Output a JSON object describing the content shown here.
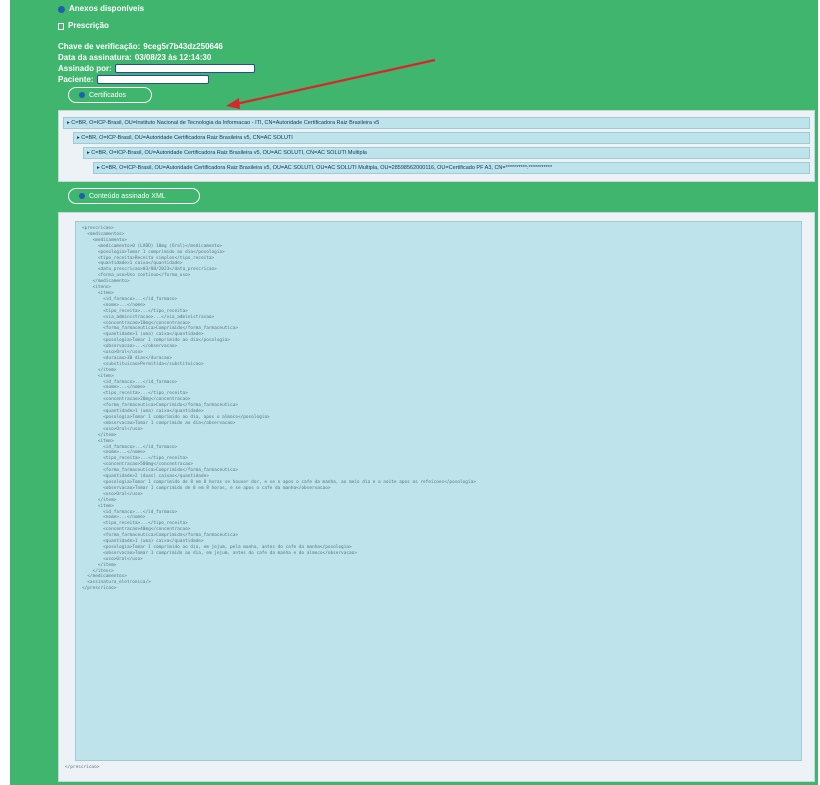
{
  "links": {
    "anexos_label": "Anexos disponíveis",
    "prescricao_label": "Prescrição"
  },
  "info": {
    "chave_label": "Chave de verificação:",
    "chave_value": "9ceg5r7b43dz250646",
    "data_label": "Data da assinatura:",
    "data_value": "03/08/23 às 12:14:30",
    "assinado_label": "Assinado por:",
    "paciente_label": "Paciente:"
  },
  "buttons": {
    "certificates_label": "Certificados",
    "xml_label": "Conteúdo assinado XML"
  },
  "chain": [
    "C=BR, O=ICP-Brasil, OU=Instituto Nacional de Tecnologia da Informacao - ITI, CN=Autoridade Certificadora Raiz Brasileira v5",
    "C=BR, O=ICP-Brasil, OU=Autoridade Certificadora Raiz Brasileira v5, CN=AC SOLUTI",
    "C=BR, O=ICP-Brasil, OU=Autoridade Certificadora Raiz Brasileira v5, OU=AC SOLUTI, CN=AC SOLUTI Multipla",
    "C=BR, O=ICP-Brasil, OU=Autoridade Certificadora Raiz Brasileira v5, OU=AC SOLUTI, OU=AC SOLUTI Multipla, OU=28598562000116, OU=Certificado PF A3, CN=**********:***********"
  ],
  "xml_lines": [
    "<prescricao>",
    "  <medicamentos>",
    "    <medicamento>",
    "      <medicamento>0 (LADO) 10mg (Oral)</medicamento>",
    "      <posologia>Tomar 1 comprimido ao dia</posologia>",
    "      <tipo_receita>Receita simples</tipo_receita>",
    "      <quantidade>1 caixa</quantidade>",
    "      <data_prescricao>03/08/2023</data_prescricao>",
    "      <forma_uso>Uso continuo</forma_uso>",
    "    </medicamento>",
    "    <itens>",
    "      <item>",
    "        <id_farmaco>...</id_farmaco>",
    "        <nome>...</nome>",
    "        <tipo_receita>...</tipo_receita>",
    "        <via_administracao>...</via_administracao>",
    "        <concentracao>10mg</concentracao>",
    "        <forma_farmaceutica>Comprimido</forma_farmaceutica>",
    "        <quantidade>1 (uma) caixa</quantidade>",
    "        <posologia>Tomar 1 comprimido ao dia</posologia>",
    "        <observacao>...</observacao>",
    "        <uso>Oral</uso>",
    "        <duracao>30 dias</duracao>",
    "        <substituicao>Permitida</substituicao>",
    "      </item>",
    "      <item>",
    "        <id_farmaco>...</id_farmaco>",
    "        <nome>...</nome>",
    "        <tipo_receita>...</tipo_receita>",
    "        <concentracao>20mg</concentracao>",
    "        <forma_farmaceutica>Comprimido</forma_farmaceutica>",
    "        <quantidade>1 (uma) caixa</quantidade>",
    "        <posologia>Tomar 1 comprimido ao dia, apos o almoco</posologia>",
    "        <observacao>Tomar 1 comprimido ao dia</observacao>",
    "        <uso>Oral</uso>",
    "      </item>",
    "      <item>",
    "        <id_farmaco>...</id_farmaco>",
    "        <nome>...</nome>",
    "        <tipo_receita>...</tipo_receita>",
    "        <concentracao>500mg</concentracao>",
    "        <forma_farmaceutica>Comprimido</forma_farmaceutica>",
    "        <quantidade>2 (duas) caixas</quantidade>",
    "        <posologia>Tomar 1 comprimido de 8 em 8 horas se houver dor, e se o apos o cafe da manha, ao meio dia e a noite apos as refeicoes</posologia>",
    "        <observacao>Tomar 1 comprimido de 8 em 8 horas, e se apos o cafe da manha</observacao>",
    "        <uso>Oral</uso>",
    "      </item>",
    "      <item>",
    "        <id_farmaco>...</id_farmaco>",
    "        <nome>...</nome>",
    "        <tipo_receita>...</tipo_receita>",
    "        <concentracao>40mg</concentracao>",
    "        <forma_farmaceutica>Comprimido</forma_farmaceutica>",
    "        <quantidade>1 (uma) caixa</quantidade>",
    "        <posologia>Tomar 1 comprimido ao dia, em jejum, pela manha, antes do cafe da manha</posologia>",
    "        <observacao>Tomar 1 comprimido ao dia, em jejum, antes do cafe da manha e do almoco</observacao>",
    "        <uso>Oral</uso>",
    "      </item>",
    "    </itens>",
    "  </medicamentos>",
    "  <assinatura_eletronica/>",
    "</prescricao>"
  ],
  "xml_footer": "</prescricao>"
}
